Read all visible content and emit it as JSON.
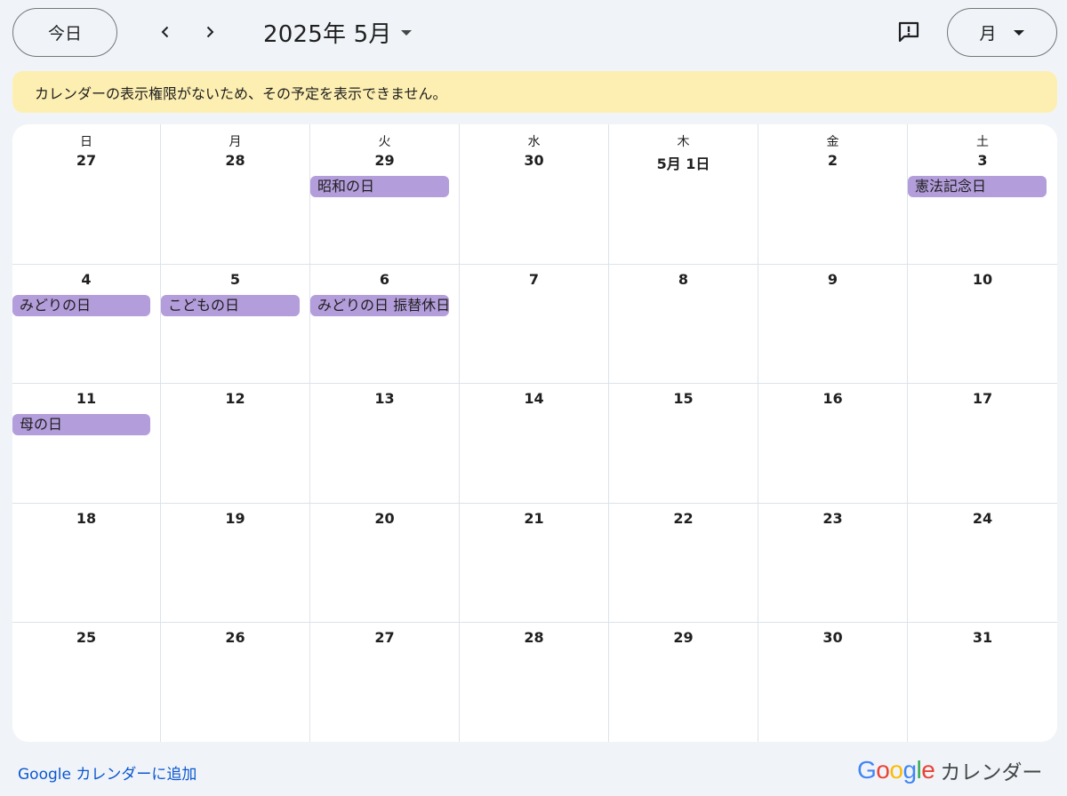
{
  "toolbar": {
    "today_label": "今日",
    "month_title": "2025年 5月",
    "view_label": "月"
  },
  "banner": {
    "text": "カレンダーの表示権限がないため、その予定を表示できません。"
  },
  "calendar": {
    "weekdays": [
      "日",
      "月",
      "火",
      "水",
      "木",
      "金",
      "土"
    ],
    "weeks": [
      [
        {
          "day": "27",
          "events": []
        },
        {
          "day": "28",
          "events": []
        },
        {
          "day": "29",
          "events": [
            "昭和の日"
          ]
        },
        {
          "day": "30",
          "events": []
        },
        {
          "day": "5月 1日",
          "events": []
        },
        {
          "day": "2",
          "events": []
        },
        {
          "day": "3",
          "events": [
            "憲法記念日"
          ]
        }
      ],
      [
        {
          "day": "4",
          "events": [
            "みどりの日"
          ]
        },
        {
          "day": "5",
          "events": [
            "こどもの日"
          ]
        },
        {
          "day": "6",
          "events": [
            "みどりの日 振替休日"
          ]
        },
        {
          "day": "7",
          "events": []
        },
        {
          "day": "8",
          "events": []
        },
        {
          "day": "9",
          "events": []
        },
        {
          "day": "10",
          "events": []
        }
      ],
      [
        {
          "day": "11",
          "events": [
            "母の日"
          ]
        },
        {
          "day": "12",
          "events": []
        },
        {
          "day": "13",
          "events": []
        },
        {
          "day": "14",
          "events": []
        },
        {
          "day": "15",
          "events": []
        },
        {
          "day": "16",
          "events": []
        },
        {
          "day": "17",
          "events": []
        }
      ],
      [
        {
          "day": "18",
          "events": []
        },
        {
          "day": "19",
          "events": []
        },
        {
          "day": "20",
          "events": []
        },
        {
          "day": "21",
          "events": []
        },
        {
          "day": "22",
          "events": []
        },
        {
          "day": "23",
          "events": []
        },
        {
          "day": "24",
          "events": []
        }
      ],
      [
        {
          "day": "25",
          "events": []
        },
        {
          "day": "26",
          "events": []
        },
        {
          "day": "27",
          "events": []
        },
        {
          "day": "28",
          "events": []
        },
        {
          "day": "29",
          "events": []
        },
        {
          "day": "30",
          "events": []
        },
        {
          "day": "31",
          "events": []
        }
      ]
    ],
    "event_color": "#b39ddb"
  },
  "footer": {
    "add_link": "Google カレンダーに追加",
    "brand_logo": "Google",
    "brand_text": "カレンダー"
  }
}
